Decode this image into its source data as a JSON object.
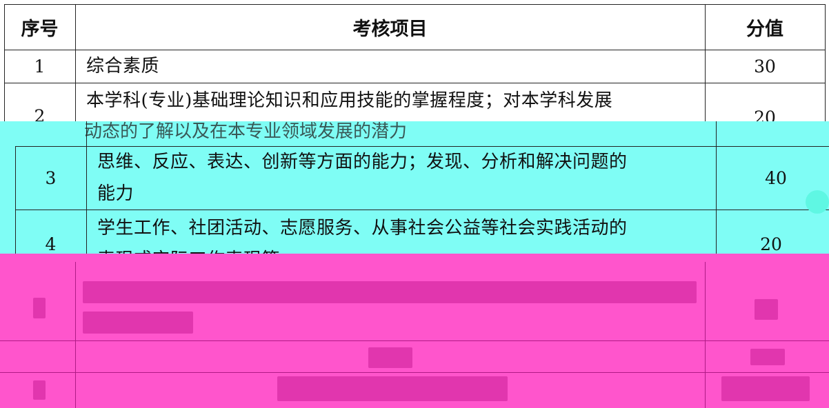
{
  "table": {
    "headers": {
      "index": "序号",
      "item": "考核项目",
      "score": "分值"
    },
    "rows": [
      {
        "index": "1",
        "item": "综合素质",
        "score": "30"
      },
      {
        "index": "2",
        "item_line1": "本学科(专业)基础理论知识和应用技能的掌握程度；对本学科发展",
        "item_line2": "动态的了解以及在本专业领域发展的潜力",
        "score": "20"
      },
      {
        "index": "3",
        "item_line1": "思维、反应、表达、创新等方面的能力；发现、分析和解决问题的",
        "item_line2": "能力",
        "score": "40"
      },
      {
        "index": "4",
        "item_line1": "学生工作、社团活动、志愿服务、从事社会公益等社会实践活动的",
        "item_line2": "表现或实际工作表现等",
        "score": "20"
      }
    ]
  },
  "colors": {
    "cyan_band": "#7ffdf5",
    "pink_band": "#ff55cc",
    "grid": "#222222"
  }
}
